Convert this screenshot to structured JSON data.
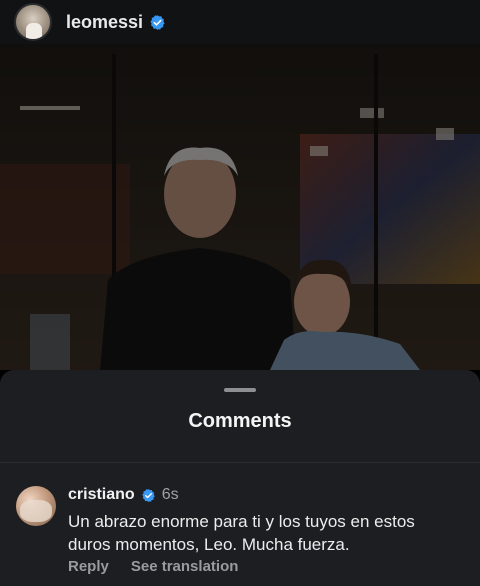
{
  "post": {
    "username": "leomessi",
    "verified_icon": "verified-badge-icon",
    "photo_alt": ""
  },
  "comments_sheet": {
    "title": "Comments"
  },
  "comment": {
    "username": "cristiano",
    "verified_icon": "verified-badge-icon",
    "time": "6s",
    "text": "Un abrazo enorme para ti y los tuyos en estos duros momentos, Leo. Mucha fuerza.",
    "reply_label": "Reply",
    "translate_label": "See translation"
  },
  "colors": {
    "verified": "#3897f0",
    "sheet_bg": "#1d1e21",
    "muted_text": "#9a9ba0"
  }
}
